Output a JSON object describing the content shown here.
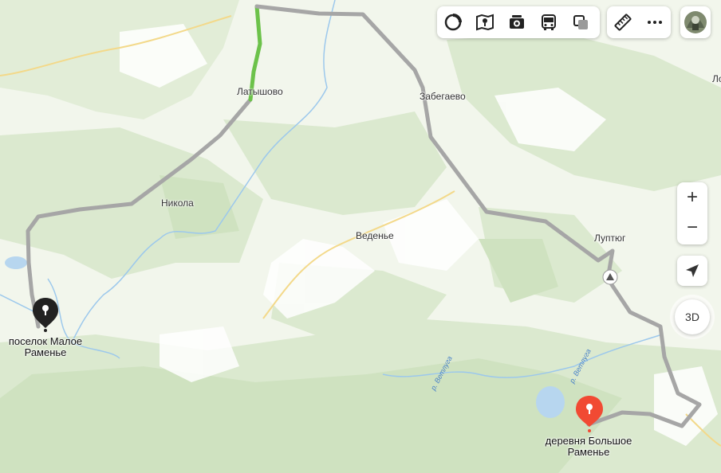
{
  "toolbar": {
    "items": [
      {
        "name": "layers-icon",
        "label": ""
      },
      {
        "name": "map-legend-icon",
        "label": ""
      },
      {
        "name": "panorama-camera-icon",
        "label": ""
      },
      {
        "name": "transit-bus-icon",
        "label": ""
      },
      {
        "name": "layers-stack-icon",
        "label": ""
      }
    ],
    "tools": [
      {
        "name": "ruler-icon",
        "label": ""
      },
      {
        "name": "more-icon",
        "label": ""
      }
    ]
  },
  "places": {
    "latyshovo": "Латышово",
    "zabegaevo": "Забегаево",
    "nikola": "Никола",
    "vedenye": "Веденье",
    "luptyug": "Луптюг",
    "lo": "Ло"
  },
  "markers": {
    "start": {
      "line1": "поселок Малое",
      "line2": "Раменье",
      "color": "#222222"
    },
    "end": {
      "line1": "деревня Большое",
      "line2": "Раменье",
      "color": "#f14a33"
    }
  },
  "rivers": {
    "vetluga_left": "р. Ветлуга",
    "vetluga_right": "р. Ветлуга"
  },
  "controls": {
    "zoom_in": "+",
    "zoom_out": "−",
    "mode_3d": "3D"
  },
  "colors": {
    "route": "#a6a6a6",
    "route_traffic": "#6cc24a",
    "forest": "#d9e8cc",
    "open_land": "#ffffff",
    "water": "#9cc8ec",
    "road": "#f3d98a"
  }
}
